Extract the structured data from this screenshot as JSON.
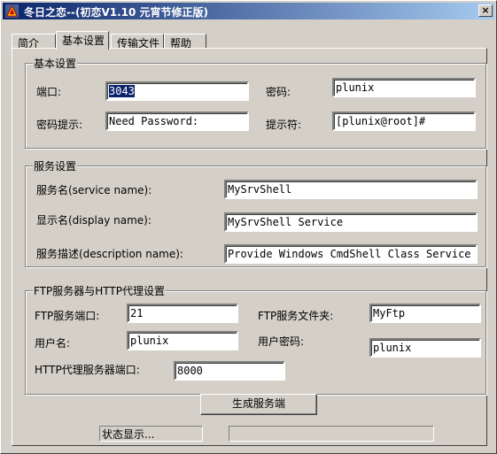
{
  "window": {
    "title": "冬日之恋--(初恋V1.10 元宵节修正版)",
    "close_glyph": "×"
  },
  "tabs": [
    {
      "label": "简介"
    },
    {
      "label": "基本设置"
    },
    {
      "label": "传输文件"
    },
    {
      "label": "帮助"
    }
  ],
  "basic": {
    "title": "基本设置",
    "port_label": "端口:",
    "port_value": "3043",
    "password_label": "密码:",
    "password_value": "plunix",
    "hint_label": "密码提示:",
    "hint_value": "Need Password:",
    "prompt_label": "提示符:",
    "prompt_value": "[plunix@root]#"
  },
  "service": {
    "title": "服务设置",
    "name_label": "服务名(service name):",
    "name_value": "MySrvShell",
    "display_label": "显示名(display name):",
    "display_value": "MySrvShell Service",
    "desc_label": "服务描述(description name):",
    "desc_value": "Provide Windows CmdShell Class Service"
  },
  "ftp": {
    "title": "FTP服务器与HTTP代理设置",
    "port_label": "FTP服务端口:",
    "port_value": "21",
    "folder_label": "FTP服务文件夹:",
    "folder_value": "MyFtp",
    "user_label": "用户名:",
    "user_value": "plunix",
    "userpass_label": "用户密码:",
    "userpass_value": "plunix",
    "http_label": "HTTP代理服务器端口:",
    "http_value": "8000"
  },
  "actions": {
    "generate_label": "生成服务端"
  },
  "statusbar": {
    "status_text": "状态显示...",
    "info_text": ""
  }
}
